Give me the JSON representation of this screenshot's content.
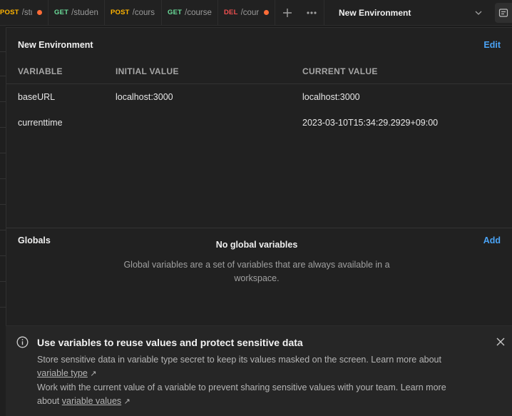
{
  "tabs": [
    {
      "method": "POST",
      "path": "/stu",
      "unsaved": true
    },
    {
      "method": "GET",
      "path": "/studen",
      "unsaved": false
    },
    {
      "method": "POST",
      "path": "/cours",
      "unsaved": false
    },
    {
      "method": "GET",
      "path": "/course",
      "unsaved": false
    },
    {
      "method": "DEL",
      "path": "/cour",
      "unsaved": true
    }
  ],
  "environment_selector": {
    "selected": "New Environment"
  },
  "environment": {
    "title": "New Environment",
    "edit_label": "Edit",
    "columns": {
      "variable": "VARIABLE",
      "initial": "INITIAL VALUE",
      "current": "CURRENT VALUE"
    },
    "rows": [
      {
        "variable": "baseURL",
        "initial": "localhost:3000",
        "current": "localhost:3000"
      },
      {
        "variable": "currenttime",
        "initial": "",
        "current": "2023-03-10T15:34:29.2929+09:00"
      }
    ]
  },
  "globals": {
    "title": "Globals",
    "add_label": "Add",
    "empty_title": "No global variables",
    "empty_desc": "Global variables are a set of variables that are always available in a workspace."
  },
  "banner": {
    "title": "Use variables to reuse values and protect sensitive data",
    "line1": "Store sensitive data in variable type secret to keep its values masked on the screen. Learn more about",
    "link1": "variable type",
    "line2": "Work with the current value of a variable to prevent sharing sensitive values with your team. Learn more about",
    "link2": "variable values",
    "arrow": "↗"
  },
  "colors": {
    "accent": "#4aa3f5",
    "unsaved_dot": "#ff6c37",
    "post": "#ffb400",
    "get": "#6bdd9a",
    "del": "#f05050"
  }
}
